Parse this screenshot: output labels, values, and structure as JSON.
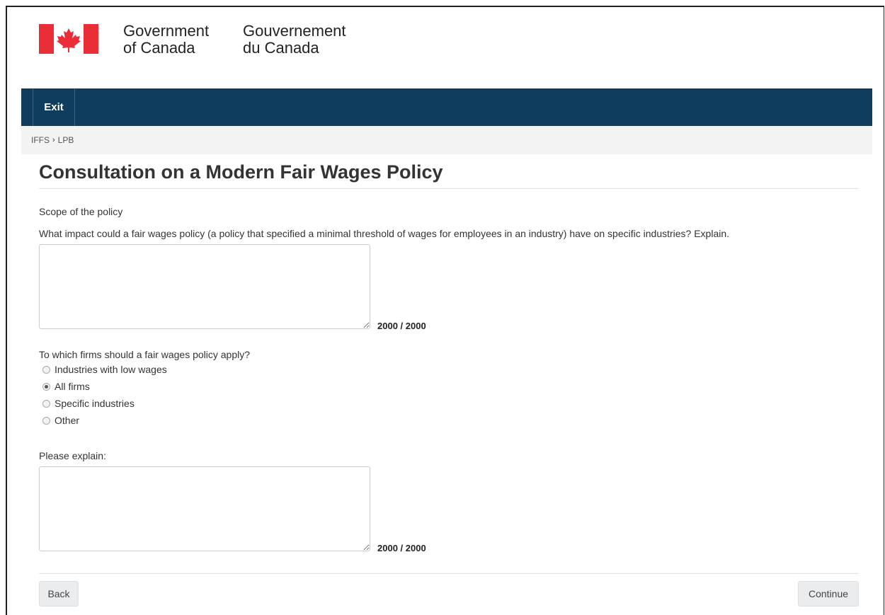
{
  "header": {
    "gov_en_line1": "Government",
    "gov_en_line2": "of Canada",
    "gov_fr_line1": "Gouvernement",
    "gov_fr_line2": "du Canada"
  },
  "nav": {
    "exit_label": "Exit"
  },
  "breadcrumb": {
    "items": [
      "IFFS",
      "LPB"
    ],
    "separator": "›"
  },
  "page": {
    "title": "Consultation on a Modern Fair Wages Policy"
  },
  "section": {
    "label": "Scope of the policy"
  },
  "question1": {
    "text": "What impact could a fair wages policy (a policy that specified a minimal threshold of wages for employees in an industry) have on specific industries? Explain.",
    "value": "",
    "counter": "2000 / 2000"
  },
  "question2": {
    "text": "To which firms should a fair wages policy apply?",
    "options": [
      "Industries with low wages",
      "All firms",
      "Specific industries",
      "Other"
    ],
    "selected": "All firms"
  },
  "question3": {
    "text": "Please explain:",
    "value": "",
    "counter": "2000 / 2000"
  },
  "buttons": {
    "back": "Back",
    "continue": "Continue"
  },
  "colors": {
    "navbar": "#0f3d5e",
    "flag_red": "#eb2d37"
  }
}
